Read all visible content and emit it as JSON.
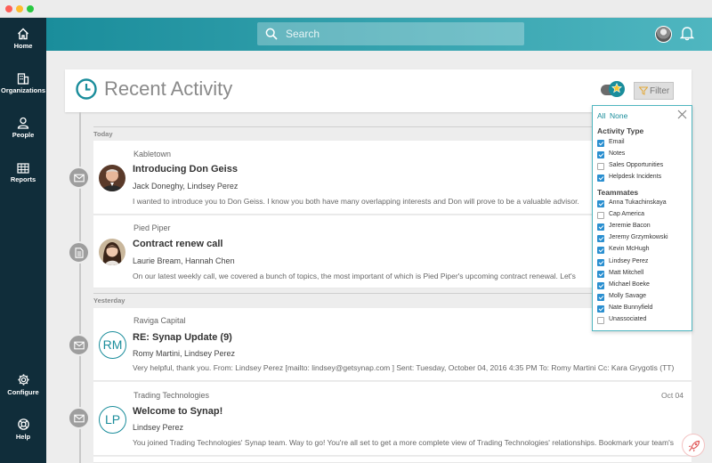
{
  "sidebar": {
    "items": [
      {
        "label": "Home",
        "icon": "home-icon"
      },
      {
        "label": "Organizations",
        "icon": "building-icon"
      },
      {
        "label": "People",
        "icon": "person-icon"
      },
      {
        "label": "Reports",
        "icon": "grid-icon"
      },
      {
        "label": "Configure",
        "icon": "gear-icon"
      },
      {
        "label": "Help",
        "icon": "lifebuoy-icon"
      }
    ]
  },
  "topbar": {
    "search_placeholder": "Search"
  },
  "header": {
    "title": "Recent Activity",
    "filter_label": "Filter"
  },
  "groups": {
    "today": "Today",
    "yesterday": "Yesterday"
  },
  "activities": [
    {
      "org": "Kabletown",
      "title": "Introducing Don Geiss",
      "people": "Jack Doneghy, Lindsey Perez",
      "body": "I wanted to introduce you to Don Geiss. I know you both have many overlapping interests and Don will prove to be a valuable advisor.",
      "icon": "mail-icon",
      "date": ""
    },
    {
      "org": "Pied Piper",
      "title": "Contract renew call",
      "people": "Laurie Bream, Hannah Chen",
      "body": "On our latest weekly call, we covered a bunch of topics, the most important of which is Pied Piper's upcoming contract renewal. Let's",
      "icon": "note-icon",
      "date": ""
    },
    {
      "org": "Raviga Capital",
      "title": "RE: Synap Update (9)",
      "people": "Romy Martini, Lindsey Perez",
      "body": "Very helpful, thank you.   From: Lindsey Perez [mailto: lindsey@getsynap.com ] Sent: Tuesday, October 04, 2016 4:35 PM To: Romy Martini Cc: Kara Grygotis (TT) Su...",
      "icon": "mail-icon",
      "initials": "RM",
      "date": ""
    },
    {
      "org": "Trading Technologies",
      "title": "Welcome to Synap!",
      "people": "Lindsey Perez",
      "body": "You joined Trading Technologies' Synap team. Way to go! You're all set to get a more complete view of Trading Technologies' relationships. Bookmark your team's we...",
      "icon": "mail-icon",
      "initials": "LP",
      "date": "Oct 04"
    }
  ],
  "filter_panel": {
    "all_label": "All",
    "none_label": "None",
    "activity_type_heading": "Activity Type",
    "activity_types": [
      {
        "label": "Email",
        "checked": true
      },
      {
        "label": "Notes",
        "checked": true
      },
      {
        "label": "Sales Opportunities",
        "checked": false
      },
      {
        "label": "Helpdesk Incidents",
        "checked": true
      }
    ],
    "teammates_heading": "Teammates",
    "teammates": [
      {
        "label": "Anna Tukachinskaya",
        "checked": true
      },
      {
        "label": "Cap America",
        "checked": false
      },
      {
        "label": "Jeremie Bacon",
        "checked": true
      },
      {
        "label": "Jeremy Grzymkowski",
        "checked": true
      },
      {
        "label": "Kevin McHugh",
        "checked": true
      },
      {
        "label": "Lindsey Perez",
        "checked": true
      },
      {
        "label": "Matt Mitchell",
        "checked": true
      },
      {
        "label": "Michael Boeke",
        "checked": true
      },
      {
        "label": "Molly Savage",
        "checked": true
      },
      {
        "label": "Nate Bunnyfield",
        "checked": true
      },
      {
        "label": "Unassociated",
        "checked": false
      }
    ]
  },
  "colors": {
    "sidebar_bg": "#102d3a",
    "accent": "#1a8d9b",
    "checkbox_on": "#2a8fd0"
  }
}
